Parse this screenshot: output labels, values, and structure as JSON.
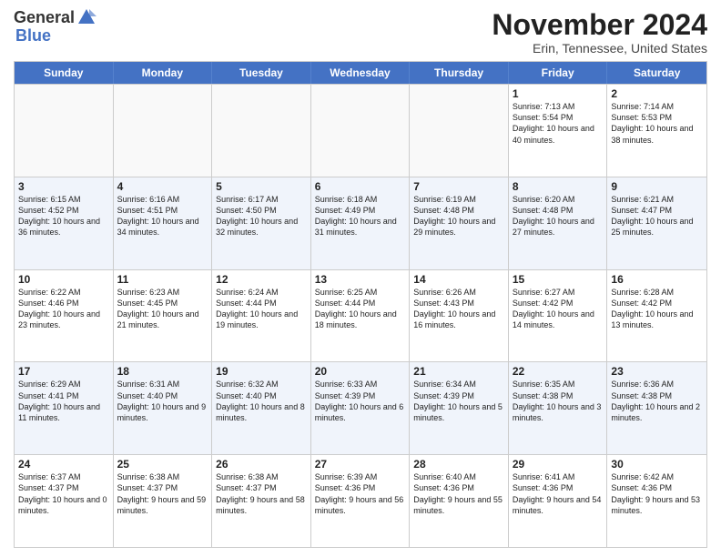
{
  "logo": {
    "general": "General",
    "blue": "Blue"
  },
  "title": "November 2024",
  "location": "Erin, Tennessee, United States",
  "weekdays": [
    "Sunday",
    "Monday",
    "Tuesday",
    "Wednesday",
    "Thursday",
    "Friday",
    "Saturday"
  ],
  "rows": [
    [
      {
        "day": "",
        "info": "",
        "empty": true
      },
      {
        "day": "",
        "info": "",
        "empty": true
      },
      {
        "day": "",
        "info": "",
        "empty": true
      },
      {
        "day": "",
        "info": "",
        "empty": true
      },
      {
        "day": "",
        "info": "",
        "empty": true
      },
      {
        "day": "1",
        "info": "Sunrise: 7:13 AM\nSunset: 5:54 PM\nDaylight: 10 hours and 40 minutes.",
        "empty": false
      },
      {
        "day": "2",
        "info": "Sunrise: 7:14 AM\nSunset: 5:53 PM\nDaylight: 10 hours and 38 minutes.",
        "empty": false
      }
    ],
    [
      {
        "day": "3",
        "info": "Sunrise: 6:15 AM\nSunset: 4:52 PM\nDaylight: 10 hours and 36 minutes.",
        "empty": false
      },
      {
        "day": "4",
        "info": "Sunrise: 6:16 AM\nSunset: 4:51 PM\nDaylight: 10 hours and 34 minutes.",
        "empty": false
      },
      {
        "day": "5",
        "info": "Sunrise: 6:17 AM\nSunset: 4:50 PM\nDaylight: 10 hours and 32 minutes.",
        "empty": false
      },
      {
        "day": "6",
        "info": "Sunrise: 6:18 AM\nSunset: 4:49 PM\nDaylight: 10 hours and 31 minutes.",
        "empty": false
      },
      {
        "day": "7",
        "info": "Sunrise: 6:19 AM\nSunset: 4:48 PM\nDaylight: 10 hours and 29 minutes.",
        "empty": false
      },
      {
        "day": "8",
        "info": "Sunrise: 6:20 AM\nSunset: 4:48 PM\nDaylight: 10 hours and 27 minutes.",
        "empty": false
      },
      {
        "day": "9",
        "info": "Sunrise: 6:21 AM\nSunset: 4:47 PM\nDaylight: 10 hours and 25 minutes.",
        "empty": false
      }
    ],
    [
      {
        "day": "10",
        "info": "Sunrise: 6:22 AM\nSunset: 4:46 PM\nDaylight: 10 hours and 23 minutes.",
        "empty": false
      },
      {
        "day": "11",
        "info": "Sunrise: 6:23 AM\nSunset: 4:45 PM\nDaylight: 10 hours and 21 minutes.",
        "empty": false
      },
      {
        "day": "12",
        "info": "Sunrise: 6:24 AM\nSunset: 4:44 PM\nDaylight: 10 hours and 19 minutes.",
        "empty": false
      },
      {
        "day": "13",
        "info": "Sunrise: 6:25 AM\nSunset: 4:44 PM\nDaylight: 10 hours and 18 minutes.",
        "empty": false
      },
      {
        "day": "14",
        "info": "Sunrise: 6:26 AM\nSunset: 4:43 PM\nDaylight: 10 hours and 16 minutes.",
        "empty": false
      },
      {
        "day": "15",
        "info": "Sunrise: 6:27 AM\nSunset: 4:42 PM\nDaylight: 10 hours and 14 minutes.",
        "empty": false
      },
      {
        "day": "16",
        "info": "Sunrise: 6:28 AM\nSunset: 4:42 PM\nDaylight: 10 hours and 13 minutes.",
        "empty": false
      }
    ],
    [
      {
        "day": "17",
        "info": "Sunrise: 6:29 AM\nSunset: 4:41 PM\nDaylight: 10 hours and 11 minutes.",
        "empty": false
      },
      {
        "day": "18",
        "info": "Sunrise: 6:31 AM\nSunset: 4:40 PM\nDaylight: 10 hours and 9 minutes.",
        "empty": false
      },
      {
        "day": "19",
        "info": "Sunrise: 6:32 AM\nSunset: 4:40 PM\nDaylight: 10 hours and 8 minutes.",
        "empty": false
      },
      {
        "day": "20",
        "info": "Sunrise: 6:33 AM\nSunset: 4:39 PM\nDaylight: 10 hours and 6 minutes.",
        "empty": false
      },
      {
        "day": "21",
        "info": "Sunrise: 6:34 AM\nSunset: 4:39 PM\nDaylight: 10 hours and 5 minutes.",
        "empty": false
      },
      {
        "day": "22",
        "info": "Sunrise: 6:35 AM\nSunset: 4:38 PM\nDaylight: 10 hours and 3 minutes.",
        "empty": false
      },
      {
        "day": "23",
        "info": "Sunrise: 6:36 AM\nSunset: 4:38 PM\nDaylight: 10 hours and 2 minutes.",
        "empty": false
      }
    ],
    [
      {
        "day": "24",
        "info": "Sunrise: 6:37 AM\nSunset: 4:37 PM\nDaylight: 10 hours and 0 minutes.",
        "empty": false
      },
      {
        "day": "25",
        "info": "Sunrise: 6:38 AM\nSunset: 4:37 PM\nDaylight: 9 hours and 59 minutes.",
        "empty": false
      },
      {
        "day": "26",
        "info": "Sunrise: 6:38 AM\nSunset: 4:37 PM\nDaylight: 9 hours and 58 minutes.",
        "empty": false
      },
      {
        "day": "27",
        "info": "Sunrise: 6:39 AM\nSunset: 4:36 PM\nDaylight: 9 hours and 56 minutes.",
        "empty": false
      },
      {
        "day": "28",
        "info": "Sunrise: 6:40 AM\nSunset: 4:36 PM\nDaylight: 9 hours and 55 minutes.",
        "empty": false
      },
      {
        "day": "29",
        "info": "Sunrise: 6:41 AM\nSunset: 4:36 PM\nDaylight: 9 hours and 54 minutes.",
        "empty": false
      },
      {
        "day": "30",
        "info": "Sunrise: 6:42 AM\nSunset: 4:36 PM\nDaylight: 9 hours and 53 minutes.",
        "empty": false
      }
    ]
  ]
}
